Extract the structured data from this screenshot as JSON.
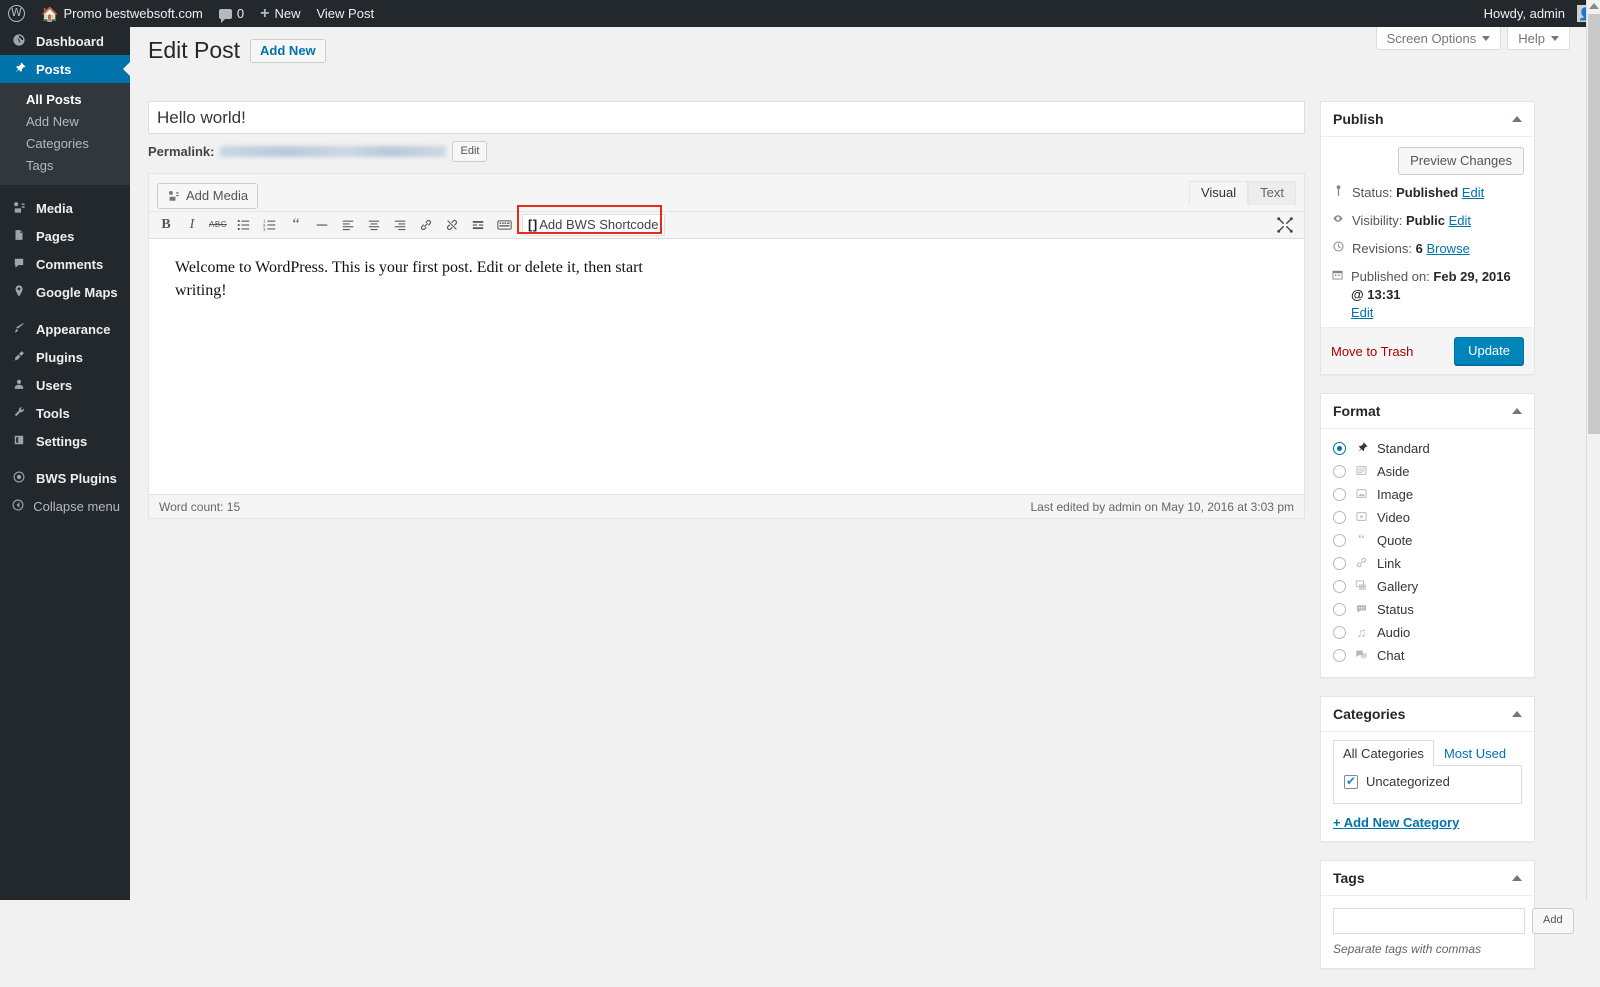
{
  "adminbar": {
    "logo_icon": "wordpress-logo-icon",
    "home_icon": "home-icon",
    "site_name": "Promo bestwebsoft.com",
    "comments_icon": "comment-bubble-icon",
    "comment_count": "0",
    "new_icon": "plus-icon",
    "new_label": "New",
    "view_post_label": "View Post",
    "howdy": "Howdy, admin",
    "avatar_icon": "user-avatar-icon"
  },
  "sidebar": {
    "items": [
      {
        "label": "Dashboard",
        "icon": "dashboard-icon",
        "current": false
      },
      {
        "label": "Posts",
        "icon": "pin-icon",
        "current": true
      },
      {
        "label": "Media",
        "icon": "media-icon",
        "current": false
      },
      {
        "label": "Pages",
        "icon": "pages-icon",
        "current": false
      },
      {
        "label": "Comments",
        "icon": "comments-icon",
        "current": false
      },
      {
        "label": "Google Maps",
        "icon": "map-marker-icon",
        "current": false
      },
      {
        "label": "Appearance",
        "icon": "paintbrush-icon",
        "current": false
      },
      {
        "label": "Plugins",
        "icon": "plug-icon",
        "current": false
      },
      {
        "label": "Users",
        "icon": "user-icon",
        "current": false
      },
      {
        "label": "Tools",
        "icon": "wrench-icon",
        "current": false
      },
      {
        "label": "Settings",
        "icon": "settings-icon",
        "current": false
      },
      {
        "label": "BWS Plugins",
        "icon": "bws-eye-icon",
        "current": false
      },
      {
        "label": "Collapse menu",
        "icon": "collapse-arrow-icon",
        "current": false
      }
    ],
    "submenu": [
      {
        "label": "All Posts",
        "current": true
      },
      {
        "label": "Add New",
        "current": false
      },
      {
        "label": "Categories",
        "current": false
      },
      {
        "label": "Tags",
        "current": false
      }
    ]
  },
  "screen_meta": {
    "screen_options": "Screen Options",
    "help": "Help"
  },
  "page": {
    "title": "Edit Post",
    "add_new_label": "Add New"
  },
  "post": {
    "title_value": "Hello world!",
    "title_placeholder": "Enter title here",
    "permalink_label": "Permalink:",
    "permalink_value": "",
    "permalink_edit_label": "Edit",
    "add_media_label": "Add Media",
    "add_media_icon": "media-add-icon",
    "tabs": {
      "visual": "Visual",
      "text": "Text"
    },
    "toolbar": [
      {
        "name": "bold-icon",
        "glyph": "B"
      },
      {
        "name": "italic-icon",
        "glyph": "I"
      },
      {
        "name": "strikethrough-icon",
        "glyph": "ABC"
      },
      {
        "name": "bulleted-list-icon",
        "glyph": ""
      },
      {
        "name": "numbered-list-icon",
        "glyph": ""
      },
      {
        "name": "blockquote-icon",
        "glyph": "“"
      },
      {
        "name": "horizontal-rule-icon",
        "glyph": "—"
      },
      {
        "name": "align-left-icon",
        "glyph": ""
      },
      {
        "name": "align-center-icon",
        "glyph": ""
      },
      {
        "name": "align-right-icon",
        "glyph": ""
      },
      {
        "name": "insert-link-icon",
        "glyph": ""
      },
      {
        "name": "remove-link-icon",
        "glyph": ""
      },
      {
        "name": "read-more-icon",
        "glyph": ""
      },
      {
        "name": "toolbar-toggle-icon",
        "glyph": ""
      }
    ],
    "bws_shortcode_label": "Add BWS Shortcode",
    "bws_shortcode_icon": "shortcode-brackets-icon",
    "fullscreen_icon": "distraction-free-icon",
    "content": "Welcome to WordPress. This is your first post. Edit or delete it, then start writing!",
    "word_count": "Word count: 15",
    "last_edited": "Last edited by admin on May 10, 2016 at 3:03 pm"
  },
  "publish": {
    "title": "Publish",
    "preview_label": "Preview Changes",
    "status_icon": "post-status-icon",
    "status_label": "Status:",
    "status_value": "Published",
    "status_edit": "Edit",
    "visibility_icon": "visibility-eye-icon",
    "visibility_label": "Visibility:",
    "visibility_value": "Public",
    "visibility_edit": "Edit",
    "revisions_icon": "revisions-clock-icon",
    "revisions_label": "Revisions:",
    "revisions_value": "6",
    "revisions_browse": "Browse",
    "published_icon": "calendar-icon",
    "published_label": "Published on:",
    "published_value": "Feb 29, 2016 @ 13:31",
    "published_edit": "Edit",
    "trash_label": "Move to Trash",
    "update_label": "Update"
  },
  "format": {
    "title": "Format",
    "options": [
      {
        "label": "Standard",
        "icon": "pin-icon",
        "selected": true
      },
      {
        "label": "Aside",
        "icon": "aside-icon",
        "selected": false
      },
      {
        "label": "Image",
        "icon": "image-icon",
        "selected": false
      },
      {
        "label": "Video",
        "icon": "video-icon",
        "selected": false
      },
      {
        "label": "Quote",
        "icon": "quote-icon",
        "selected": false
      },
      {
        "label": "Link",
        "icon": "link-icon",
        "selected": false
      },
      {
        "label": "Gallery",
        "icon": "gallery-icon",
        "selected": false
      },
      {
        "label": "Status",
        "icon": "status-icon",
        "selected": false
      },
      {
        "label": "Audio",
        "icon": "audio-icon",
        "selected": false
      },
      {
        "label": "Chat",
        "icon": "chat-icon",
        "selected": false
      }
    ]
  },
  "categories": {
    "title": "Categories",
    "tabs": [
      {
        "label": "All Categories",
        "active": true
      },
      {
        "label": "Most Used",
        "active": false
      }
    ],
    "items": [
      {
        "label": "Uncategorized",
        "checked": true
      }
    ],
    "add_new_label": "+ Add New Category"
  },
  "tags": {
    "title": "Tags",
    "input_value": "",
    "input_placeholder": "",
    "add_label": "Add",
    "description": "Separate tags with commas"
  },
  "colors": {
    "admin_bar": "#23282d",
    "sidebar": "#23282d",
    "accent": "#0073aa",
    "primary_button": "#0085ba",
    "highlight_box": "#e52b1e",
    "link": "#0073aa",
    "trash": "#a00"
  }
}
